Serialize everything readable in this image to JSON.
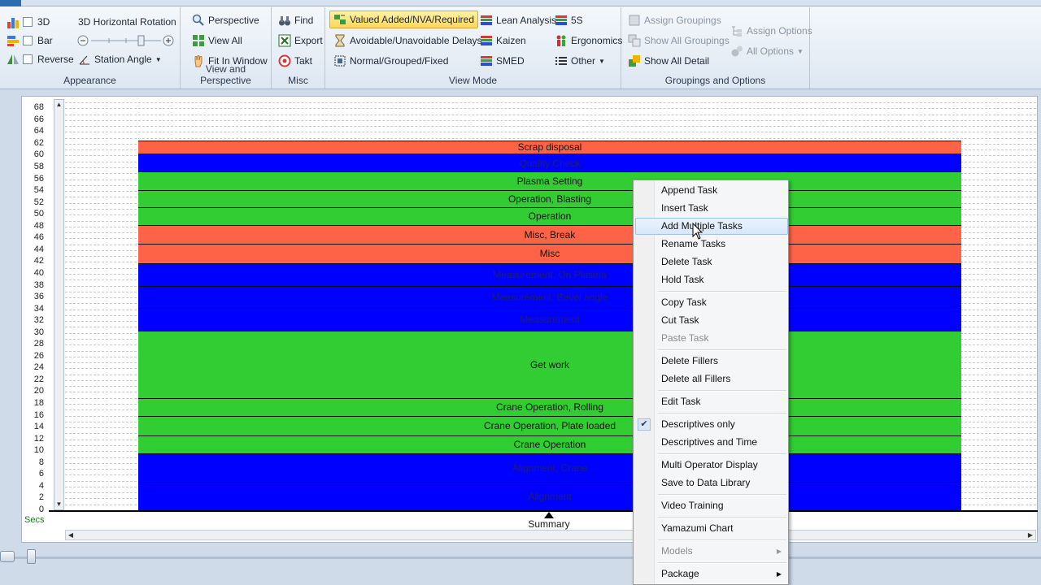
{
  "ribbon": {
    "appearance": {
      "label": "Appearance",
      "cb_3d": "3D",
      "cb_bar": "Bar",
      "cb_reverse": "Reverse",
      "rotation_label": "3D Horizontal Rotation",
      "station_angle": "Station Angle"
    },
    "view_perspective": {
      "label": "View and Perspective",
      "perspective": "Perspective",
      "view_all": "View All",
      "fit_in_window": "Fit In Window"
    },
    "misc": {
      "label": "Misc",
      "find": "Find",
      "export": "Export",
      "takt": "Takt"
    },
    "view_mode": {
      "label": "View Mode",
      "valued_added": "Valued Added/NVA/Required",
      "avoidable": "Avoidable/Unavoidable Delays",
      "normal_grouped": "Normal/Grouped/Fixed",
      "lean_analysis": "Lean Analysis",
      "kaizen": "Kaizen",
      "smed": "SMED",
      "five_s": "5S",
      "ergonomics": "Ergonomics",
      "other": "Other"
    },
    "groupings": {
      "label": "Groupings and Options",
      "assign_groupings": "Assign Groupings",
      "show_all_groupings": "Show All Groupings",
      "show_all_detail": "Show All Detail",
      "assign_options": "Assign Options",
      "all_options": "All Options"
    }
  },
  "colors": {
    "red": "#ff6347",
    "blue": "#0000ff",
    "green": "#32cd32"
  },
  "chart_data": {
    "type": "bar",
    "ylabel": "Secs",
    "ylim": [
      0,
      69
    ],
    "yticks": [
      0,
      2,
      4,
      6,
      8,
      10,
      12,
      14,
      16,
      18,
      20,
      22,
      24,
      26,
      28,
      30,
      32,
      34,
      36,
      38,
      40,
      42,
      44,
      46,
      48,
      50,
      52,
      54,
      56,
      58,
      60,
      62,
      64,
      66,
      68
    ],
    "categories": [
      "Summary"
    ],
    "segments": [
      {
        "name": "Alignment",
        "start": 0,
        "end": 4.8,
        "color": "blue"
      },
      {
        "name": "Alignment, Crane",
        "start": 4.8,
        "end": 9.6,
        "color": "blue"
      },
      {
        "name": "Crane Operation",
        "start": 9.6,
        "end": 12.7,
        "color": "green"
      },
      {
        "name": "Crane Operation, Plate loaded",
        "start": 12.7,
        "end": 16.0,
        "color": "green"
      },
      {
        "name": "Crane Operation, Rolling",
        "start": 16.0,
        "end": 19.0,
        "color": "green"
      },
      {
        "name": "Get work",
        "start": 19.0,
        "end": 30.4,
        "color": "green"
      },
      {
        "name": "Measurement",
        "start": 30.4,
        "end": 34.2,
        "color": "blue"
      },
      {
        "name": "Measurement, Bevel angle",
        "start": 34.2,
        "end": 38.0,
        "color": "blue"
      },
      {
        "name": "Measurement, On Plasma",
        "start": 38.0,
        "end": 41.8,
        "color": "blue"
      },
      {
        "name": "Misc",
        "start": 41.8,
        "end": 45.1,
        "color": "red"
      },
      {
        "name": "Misc, Break",
        "start": 45.1,
        "end": 48.3,
        "color": "red"
      },
      {
        "name": "Operation",
        "start": 48.3,
        "end": 51.3,
        "color": "green"
      },
      {
        "name": "Operation, Blasting",
        "start": 51.3,
        "end": 54.2,
        "color": "green"
      },
      {
        "name": "Plasma Setting",
        "start": 54.2,
        "end": 57.3,
        "color": "green"
      },
      {
        "name": "Quality Check",
        "start": 57.3,
        "end": 60.3,
        "color": "blue"
      },
      {
        "name": "Scrap disposal",
        "start": 60.3,
        "end": 62.6,
        "color": "red"
      }
    ]
  },
  "context_menu": {
    "items": [
      {
        "label": "Append Task"
      },
      {
        "label": "Insert Task"
      },
      {
        "label": "Add Multiple Tasks",
        "hover": true
      },
      {
        "label": "Rename Tasks"
      },
      {
        "label": "Delete Task"
      },
      {
        "label": "Hold Task",
        "sep_after": true
      },
      {
        "label": "Copy Task"
      },
      {
        "label": "Cut Task"
      },
      {
        "label": "Paste Task",
        "disabled": true,
        "sep_after": true
      },
      {
        "label": "Delete Fillers"
      },
      {
        "label": "Delete all Fillers",
        "sep_after": true
      },
      {
        "label": "Edit Task",
        "sep_after": true
      },
      {
        "label": "Descriptives only",
        "checked": true
      },
      {
        "label": "Descriptives and Time",
        "sep_after": true
      },
      {
        "label": "Multi Operator Display"
      },
      {
        "label": "Save to Data Library",
        "sep_after": true
      },
      {
        "label": "Video Training",
        "sep_after": true
      },
      {
        "label": "Yamazumi Chart",
        "sep_after": true
      },
      {
        "label": "Models",
        "disabled": true,
        "submenu": true,
        "sep_after": true
      },
      {
        "label": "Package",
        "submenu": true
      }
    ]
  }
}
